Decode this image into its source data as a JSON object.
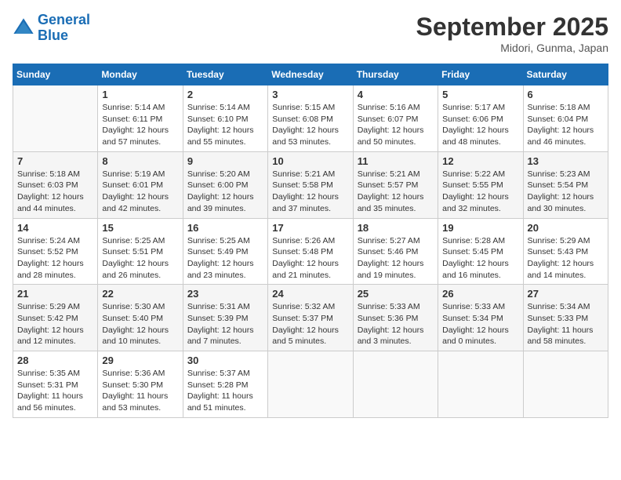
{
  "header": {
    "logo_line1": "General",
    "logo_line2": "Blue",
    "month": "September 2025",
    "location": "Midori, Gunma, Japan"
  },
  "days_of_week": [
    "Sunday",
    "Monday",
    "Tuesday",
    "Wednesday",
    "Thursday",
    "Friday",
    "Saturday"
  ],
  "weeks": [
    [
      {
        "day": "",
        "info": ""
      },
      {
        "day": "1",
        "info": "Sunrise: 5:14 AM\nSunset: 6:11 PM\nDaylight: 12 hours\nand 57 minutes."
      },
      {
        "day": "2",
        "info": "Sunrise: 5:14 AM\nSunset: 6:10 PM\nDaylight: 12 hours\nand 55 minutes."
      },
      {
        "day": "3",
        "info": "Sunrise: 5:15 AM\nSunset: 6:08 PM\nDaylight: 12 hours\nand 53 minutes."
      },
      {
        "day": "4",
        "info": "Sunrise: 5:16 AM\nSunset: 6:07 PM\nDaylight: 12 hours\nand 50 minutes."
      },
      {
        "day": "5",
        "info": "Sunrise: 5:17 AM\nSunset: 6:06 PM\nDaylight: 12 hours\nand 48 minutes."
      },
      {
        "day": "6",
        "info": "Sunrise: 5:18 AM\nSunset: 6:04 PM\nDaylight: 12 hours\nand 46 minutes."
      }
    ],
    [
      {
        "day": "7",
        "info": "Sunrise: 5:18 AM\nSunset: 6:03 PM\nDaylight: 12 hours\nand 44 minutes."
      },
      {
        "day": "8",
        "info": "Sunrise: 5:19 AM\nSunset: 6:01 PM\nDaylight: 12 hours\nand 42 minutes."
      },
      {
        "day": "9",
        "info": "Sunrise: 5:20 AM\nSunset: 6:00 PM\nDaylight: 12 hours\nand 39 minutes."
      },
      {
        "day": "10",
        "info": "Sunrise: 5:21 AM\nSunset: 5:58 PM\nDaylight: 12 hours\nand 37 minutes."
      },
      {
        "day": "11",
        "info": "Sunrise: 5:21 AM\nSunset: 5:57 PM\nDaylight: 12 hours\nand 35 minutes."
      },
      {
        "day": "12",
        "info": "Sunrise: 5:22 AM\nSunset: 5:55 PM\nDaylight: 12 hours\nand 32 minutes."
      },
      {
        "day": "13",
        "info": "Sunrise: 5:23 AM\nSunset: 5:54 PM\nDaylight: 12 hours\nand 30 minutes."
      }
    ],
    [
      {
        "day": "14",
        "info": "Sunrise: 5:24 AM\nSunset: 5:52 PM\nDaylight: 12 hours\nand 28 minutes."
      },
      {
        "day": "15",
        "info": "Sunrise: 5:25 AM\nSunset: 5:51 PM\nDaylight: 12 hours\nand 26 minutes."
      },
      {
        "day": "16",
        "info": "Sunrise: 5:25 AM\nSunset: 5:49 PM\nDaylight: 12 hours\nand 23 minutes."
      },
      {
        "day": "17",
        "info": "Sunrise: 5:26 AM\nSunset: 5:48 PM\nDaylight: 12 hours\nand 21 minutes."
      },
      {
        "day": "18",
        "info": "Sunrise: 5:27 AM\nSunset: 5:46 PM\nDaylight: 12 hours\nand 19 minutes."
      },
      {
        "day": "19",
        "info": "Sunrise: 5:28 AM\nSunset: 5:45 PM\nDaylight: 12 hours\nand 16 minutes."
      },
      {
        "day": "20",
        "info": "Sunrise: 5:29 AM\nSunset: 5:43 PM\nDaylight: 12 hours\nand 14 minutes."
      }
    ],
    [
      {
        "day": "21",
        "info": "Sunrise: 5:29 AM\nSunset: 5:42 PM\nDaylight: 12 hours\nand 12 minutes."
      },
      {
        "day": "22",
        "info": "Sunrise: 5:30 AM\nSunset: 5:40 PM\nDaylight: 12 hours\nand 10 minutes."
      },
      {
        "day": "23",
        "info": "Sunrise: 5:31 AM\nSunset: 5:39 PM\nDaylight: 12 hours\nand 7 minutes."
      },
      {
        "day": "24",
        "info": "Sunrise: 5:32 AM\nSunset: 5:37 PM\nDaylight: 12 hours\nand 5 minutes."
      },
      {
        "day": "25",
        "info": "Sunrise: 5:33 AM\nSunset: 5:36 PM\nDaylight: 12 hours\nand 3 minutes."
      },
      {
        "day": "26",
        "info": "Sunrise: 5:33 AM\nSunset: 5:34 PM\nDaylight: 12 hours\nand 0 minutes."
      },
      {
        "day": "27",
        "info": "Sunrise: 5:34 AM\nSunset: 5:33 PM\nDaylight: 11 hours\nand 58 minutes."
      }
    ],
    [
      {
        "day": "28",
        "info": "Sunrise: 5:35 AM\nSunset: 5:31 PM\nDaylight: 11 hours\nand 56 minutes."
      },
      {
        "day": "29",
        "info": "Sunrise: 5:36 AM\nSunset: 5:30 PM\nDaylight: 11 hours\nand 53 minutes."
      },
      {
        "day": "30",
        "info": "Sunrise: 5:37 AM\nSunset: 5:28 PM\nDaylight: 11 hours\nand 51 minutes."
      },
      {
        "day": "",
        "info": ""
      },
      {
        "day": "",
        "info": ""
      },
      {
        "day": "",
        "info": ""
      },
      {
        "day": "",
        "info": ""
      }
    ]
  ]
}
